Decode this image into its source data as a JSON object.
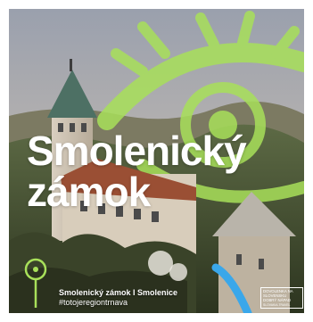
{
  "headline": {
    "line1": "Smolenický",
    "line2": "zámok"
  },
  "caption": {
    "place": "Smolenický zámok I Smolenice",
    "hashtag": "#totojeregiontrnava"
  },
  "brand_logo": {
    "lines": [
      "Dovolenka na",
      "Slovensku",
      "Dobrý nápad"
    ],
    "tagline": "slovakia.travel"
  },
  "colors": {
    "accent_green": "#a8e05a",
    "accent_blue": "#3aa7ea"
  },
  "icons": [
    "map-pin-icon",
    "eye-graphic"
  ]
}
